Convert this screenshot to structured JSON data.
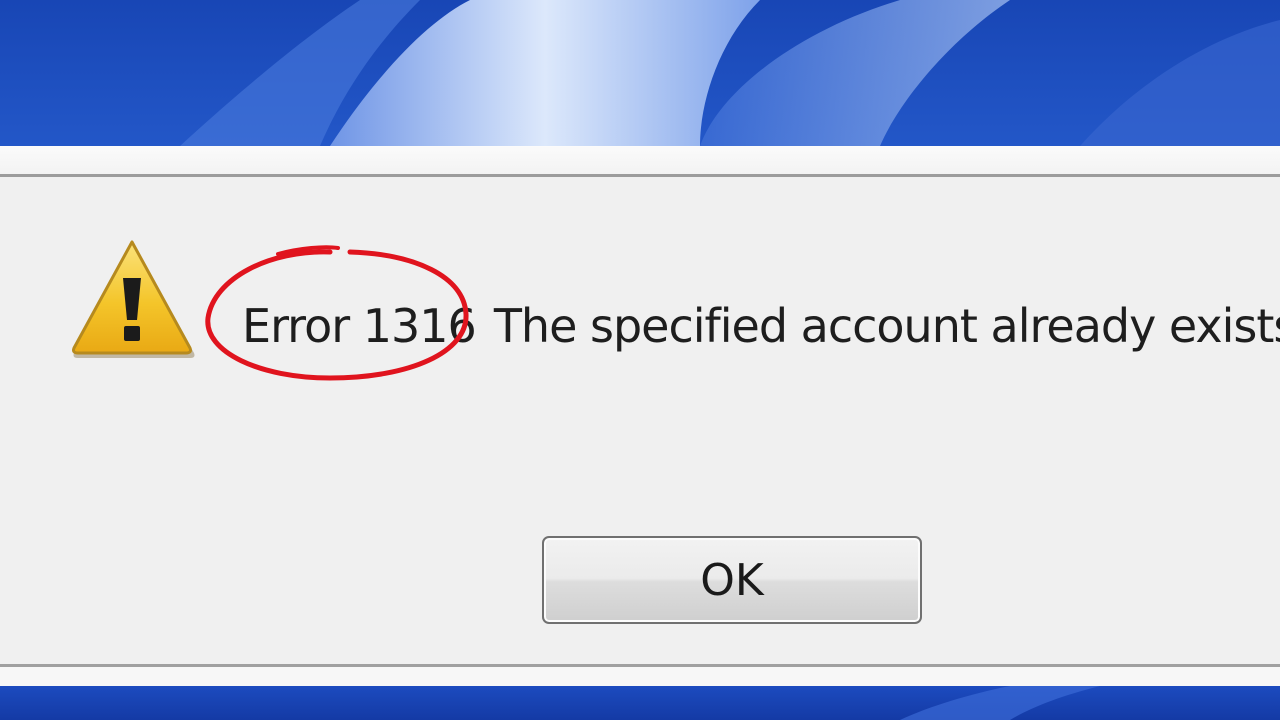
{
  "dialog": {
    "error_code": "Error 1316",
    "message": "The specified account already exists.",
    "ok_label": "OK",
    "icon": "warning-icon"
  },
  "annotation": {
    "highlight": "red-circle",
    "color": "#e0141e"
  },
  "colors": {
    "desktop_blue": "#1f52c2",
    "dialog_background": "#f0f0f0",
    "warning_yellow": "#f5c62a"
  }
}
